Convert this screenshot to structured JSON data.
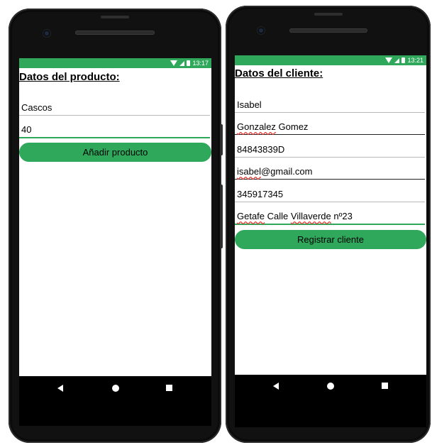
{
  "colors": {
    "accent": "#2fa85b",
    "text": "#000000"
  },
  "left_phone": {
    "status_time": "13:17",
    "title": "Datos del producto:",
    "fields": [
      {
        "value": "Cascos"
      },
      {
        "value": "40"
      }
    ],
    "button_label": "Añadir producto",
    "nav": {
      "back": "back-icon",
      "home": "home-icon",
      "recent": "recent-apps-icon"
    }
  },
  "right_phone": {
    "status_time": "13:21",
    "title": "Datos del cliente:",
    "fields": [
      {
        "value": "Isabel"
      },
      {
        "value_a": "Gonzalez",
        "value_b": " Gomez"
      },
      {
        "value": "84843839D"
      },
      {
        "value_a": "isabel",
        "value_b": "@gmail.com"
      },
      {
        "value": "345917345"
      },
      {
        "value_a": "Getafe",
        "value_b": " Calle ",
        "value_c": "Villaverde",
        "value_d": " nº23"
      }
    ],
    "button_label": "Registrar cliente",
    "nav": {
      "back": "back-icon",
      "home": "home-icon",
      "recent": "recent-apps-icon"
    }
  }
}
